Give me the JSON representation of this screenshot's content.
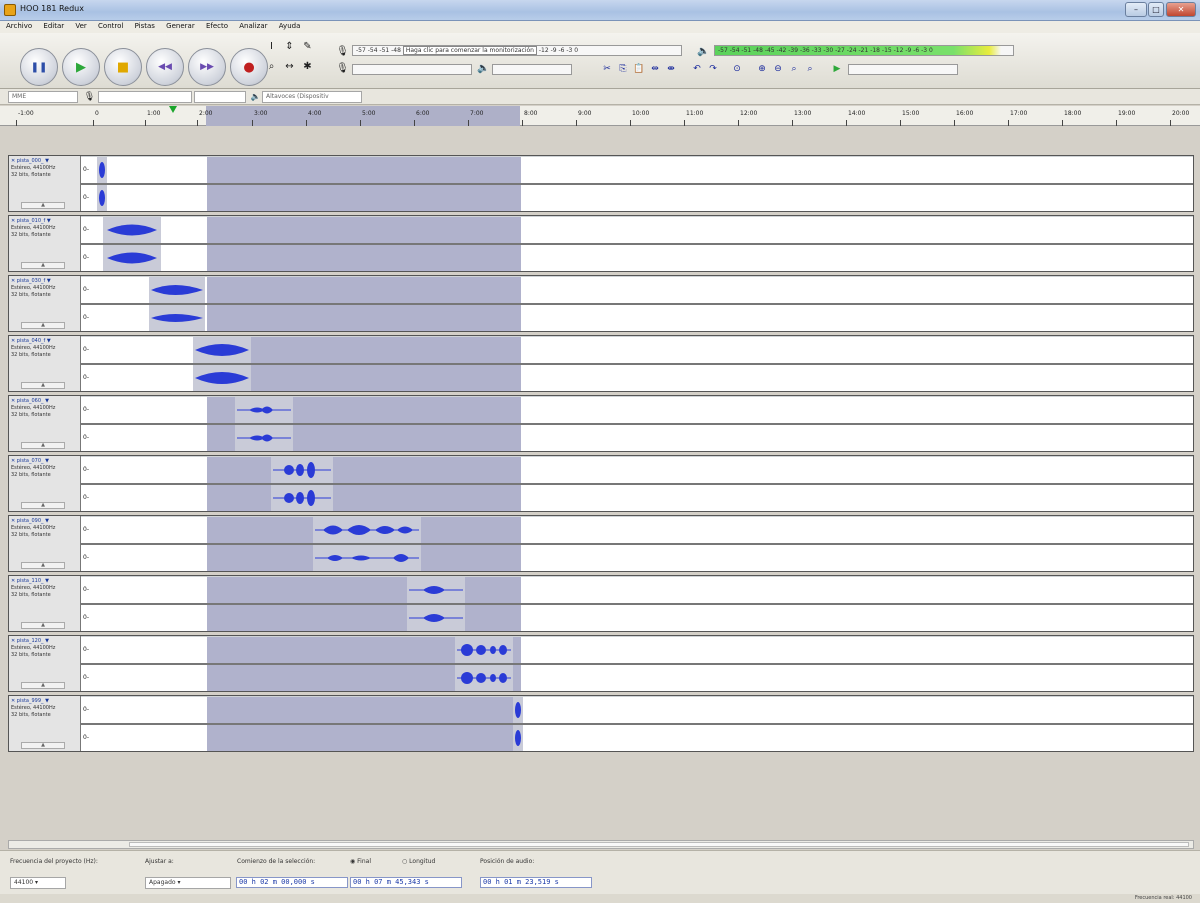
{
  "window": {
    "title": "HOO 181 Redux"
  },
  "menu": [
    "Archivo",
    "Editar",
    "Ver",
    "Control",
    "Pistas",
    "Generar",
    "Efecto",
    "Analizar",
    "Ayuda"
  ],
  "transport": {
    "pause": "❚❚",
    "play": "▶",
    "stop": "■",
    "skip_start": "◀◀",
    "skip_end": "▶▶",
    "record": "●"
  },
  "tools": [
    "I",
    "⇕",
    "✎",
    "⌕",
    "↔",
    "✱"
  ],
  "meters": {
    "record_ticks": "-57 -54 -51 -48",
    "record_hint": "Haga clic para comenzar la monitorización",
    "record_tail": "-12 -9 -6 -3 0",
    "play_scale": "-57 -54 -51 -48 -45 -42 -39 -36 -33 -30 -27 -24 -21 -18 -15 -12 -9 -6 -3 0"
  },
  "devices": {
    "host": "MME",
    "output": "Altavoces (Dispositiv"
  },
  "ruler": {
    "ticks": [
      "-1:00",
      "0",
      "1:00",
      "2:00",
      "3:00",
      "4:00",
      "5:00",
      "6:00",
      "7:00",
      "8:00",
      "9:00",
      "10:00",
      "11:00",
      "12:00",
      "13:00",
      "14:00",
      "15:00",
      "16:00",
      "17:00",
      "18:00",
      "19:00",
      "20:00"
    ]
  },
  "tracks": [
    {
      "name": "pista_000_",
      "info": "Estéreo, 44100Hz\n32 bits, flotante",
      "zero": "0-"
    },
    {
      "name": "pista_010_f",
      "info": "Estéreo, 44100Hz\n32 bits, flotante",
      "zero": "0-"
    },
    {
      "name": "pista_030_f",
      "info": "Estéreo, 44100Hz\n32 bits, flotante",
      "zero": "0-"
    },
    {
      "name": "pista_040_f",
      "info": "Estéreo, 44100Hz\n32 bits, flotante",
      "zero": "0-"
    },
    {
      "name": "pista_060_",
      "info": "Estéreo, 44100Hz\n32 bits, flotante",
      "zero": "0-"
    },
    {
      "name": "pista_070_",
      "info": "Estéreo, 44100Hz\n32 bits, flotante",
      "zero": "0-"
    },
    {
      "name": "pista_090_",
      "info": "Estéreo, 44100Hz\n32 bits, flotante",
      "zero": "0-"
    },
    {
      "name": "pista_110_",
      "info": "Estéreo, 44100Hz\n32 bits, flotante",
      "zero": "0-"
    },
    {
      "name": "pista_120_",
      "info": "Estéreo, 44100Hz\n32 bits, flotante",
      "zero": "0-"
    },
    {
      "name": "pista_999_",
      "info": "Estéreo, 44100Hz\n32 bits, flotante",
      "zero": "0-"
    }
  ],
  "selection": {
    "rate_label": "Frecuencia del proyecto (Hz):",
    "rate_value": "44100",
    "snap_label": "Ajustar a:",
    "snap_value": "Apagado",
    "start_label": "Comienzo de la selección:",
    "end_radio": "Final",
    "length_radio": "Longitud",
    "audio_pos_label": "Posición de audio:",
    "start_time": "00 h 02 m 00,000 s",
    "end_time": "00 h 07 m 45,343 s",
    "audio_pos": "00 h 01 m 23,519 s"
  },
  "status": {
    "right": "Frecuencia real: 44100"
  },
  "colors": {
    "selection": "#aeb0c8",
    "waveform": "#2a3bd6",
    "playhead": "#1aa52b"
  }
}
